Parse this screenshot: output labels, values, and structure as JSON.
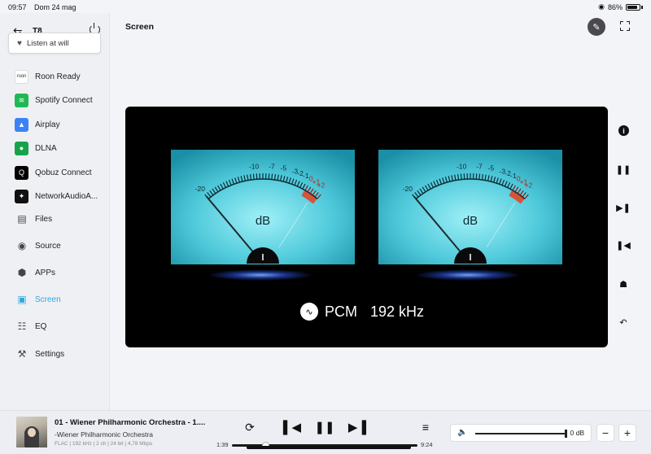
{
  "status": {
    "time": "09:57",
    "date": "Dom 24 mag",
    "battery": "86%",
    "battery_level": 0.86
  },
  "sidebar": {
    "device_name": "T8",
    "listen_label": "Listen at will",
    "sources": [
      {
        "label": "Roon Ready",
        "icon": "roon-icon",
        "color": "#ffffff"
      },
      {
        "label": "Spotify Connect",
        "icon": "spotify-icon",
        "color": "#1db954"
      },
      {
        "label": "Airplay",
        "icon": "airplay-icon",
        "color": "#3b82f6"
      },
      {
        "label": "DLNA",
        "icon": "dlna-icon",
        "color": "#16a34a"
      },
      {
        "label": "Qobuz Connect",
        "icon": "qobuz-icon",
        "color": "#000000"
      },
      {
        "label": "NetworkAudioA...",
        "icon": "networkaudio-icon",
        "color": "#111111"
      }
    ],
    "nav": [
      {
        "label": "Files",
        "icon": "folder-icon"
      },
      {
        "label": "Source",
        "icon": "source-icon"
      },
      {
        "label": "APPs",
        "icon": "apps-icon"
      },
      {
        "label": "Screen",
        "icon": "screen-icon",
        "active": true
      },
      {
        "label": "EQ",
        "icon": "eq-icon"
      },
      {
        "label": "Settings",
        "icon": "settings-icon"
      }
    ],
    "accent_color": "#2fa8da"
  },
  "main": {
    "title": "Screen"
  },
  "meters": {
    "scale_labels": [
      "-20",
      "-10",
      "-7",
      "-5",
      "-3",
      "-2",
      "-1",
      "0",
      "+1",
      "+2"
    ],
    "unit": "dB",
    "left_needle_db": -20,
    "right_needle_db": -20,
    "face_color": "#4ec9da",
    "redzone_color": "#d6533a"
  },
  "format": {
    "codec": "PCM",
    "sample_rate": "192 kHz"
  },
  "player": {
    "title": "01 - Wiener Philharmonic Orchestra - 1....",
    "artist": "-Wiener Philharmonic Orchestra",
    "format_info": "FLAC | 192 kHz | 2 ch | 24 bit | 4,78 Mbps",
    "elapsed": "1:39",
    "duration": "9:24",
    "progress_fraction": 0.18,
    "volume_label": "0 dB",
    "volume_fraction": 1.0
  }
}
